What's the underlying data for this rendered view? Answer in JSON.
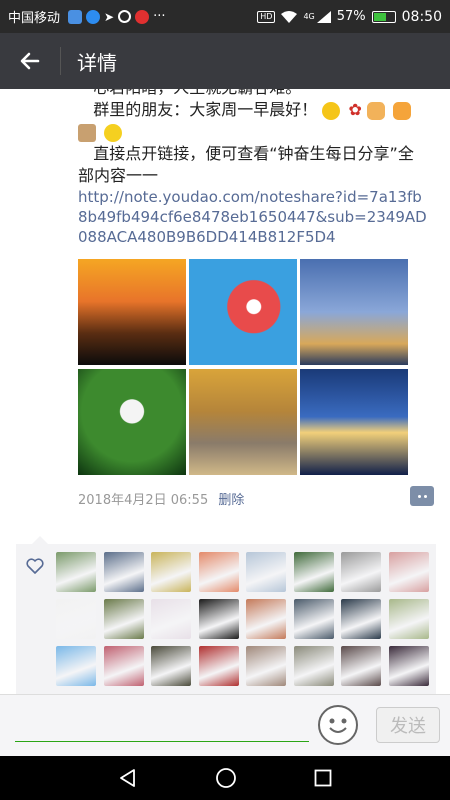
{
  "status_bar": {
    "carrier": "中国移动",
    "app_icons": [
      {
        "name": "app-icon-1",
        "color": "#4a90e2"
      },
      {
        "name": "app-icon-2",
        "color": "#2d8cf0"
      },
      {
        "name": "telegram-icon",
        "color": "#ffffff"
      },
      {
        "name": "app-icon-4",
        "color": "#ffffff"
      },
      {
        "name": "video-icon",
        "color": "#e03030"
      }
    ],
    "more": "···",
    "hd_badge": "HD",
    "network": "4G",
    "battery_percent": "57%",
    "battery_level": 57,
    "time": "08:50"
  },
  "header": {
    "title": "详情"
  },
  "post": {
    "line1": "心若阳暗，人生就无霸谷难。",
    "line2": "群里的朋友：大家周一早晨好！",
    "line3": "直接点开链接，便可查看“钟奋生每日分享”全部内容一一",
    "link": "http://note.youdao.com/noteshare?id=7a13fb8b49fb494cf6e8478eb1650447&sub=2349AD088ACA480B9B6DD414B812F5D4",
    "timestamp": "2018年4月2日 06:55",
    "delete_label": "删除"
  },
  "photos": [
    {
      "name": "photo-sunset-crane",
      "bg": "linear-gradient(180deg,#f5a623 0%,#e8742a 40%,#5a2d12 70%,#0b0b0b 100%)"
    },
    {
      "name": "photo-ferris-wheel",
      "bg": "radial-gradient(circle at 60% 45%,#ffffff 0 8%,#e84b4b 9% 30%,#3aa0e0 31% 100%)"
    },
    {
      "name": "photo-city-skyline",
      "bg": "linear-gradient(180deg,#4a6fb0 0%,#8aa7d8 50%,#d8a85a 80%,#2a3b5e 100%)"
    },
    {
      "name": "photo-white-flowers",
      "bg": "radial-gradient(circle at 50% 40%,#f4f4f4 0 14%,#3d8a2e 15% 60%,#0d3410 100%)"
    },
    {
      "name": "photo-cottage-autumn",
      "bg": "linear-gradient(180deg,#d9a43a 0%,#b5853a 40%,#8a7b6a 70%,#d0b888 100%)"
    },
    {
      "name": "photo-bridge-night",
      "bg": "linear-gradient(180deg,#1a3a78 0%,#3a6bc0 45%,#f2d07a 60%,#11204a 100%)"
    }
  ],
  "likers": [
    "#7a9a6a",
    "#5b6e8a",
    "#c9b45a",
    "#e48a6a",
    "#b6c6d8",
    "#3f6a3a",
    "#9a9a9a",
    "#d8a0a0",
    "#f2f2f2",
    "#6a7a4a",
    "#e8e0e8",
    "#1a1a1a",
    "#c47a5a",
    "#4a5a6a",
    "#2a3a4a",
    "#a8b88a",
    "#7ab8e8",
    "#c06070",
    "#4a4a3a",
    "#b03030",
    "#a0887a",
    "#8a8a7a",
    "#5a4a4a",
    "#3a2a3a"
  ],
  "input": {
    "send_label": "发送"
  }
}
